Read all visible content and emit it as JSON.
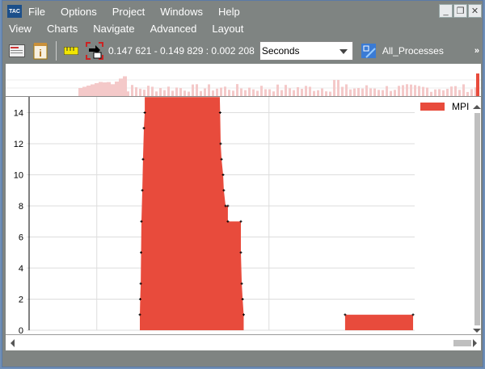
{
  "app": {
    "logo_text": "TAC"
  },
  "menubar1": [
    "File",
    "Options",
    "Project",
    "Windows",
    "Help"
  ],
  "menubar2": [
    "View",
    "Charts",
    "Navigate",
    "Advanced",
    "Layout"
  ],
  "window_controls": {
    "minimize": "_",
    "restore": "❐",
    "close": "✕"
  },
  "toolbar": {
    "icons": [
      "chart-list-icon",
      "info-calendar-icon",
      "ruler-icon",
      "goto-selection-icon"
    ],
    "time_range": "0.147 621 - 0.149 829 : 0.002 208",
    "unit_select": "Seconds",
    "process_group": "All_Processes",
    "overflow": "»"
  },
  "colors": {
    "series": "#e84b3c",
    "overview": "#f4c9c9",
    "chrome": "#7f8482"
  },
  "chart_data": {
    "type": "area",
    "step": true,
    "xlim": [
      0.147621,
      0.149829
    ],
    "xunit": "Seconds",
    "ylim": [
      0,
      15
    ],
    "yticks": [
      0,
      2,
      4,
      6,
      8,
      10,
      12,
      14
    ],
    "grid": true,
    "legend": "top-right",
    "series": [
      {
        "name": "MPI",
        "points": [
          [
            0.148265,
            0
          ],
          [
            0.148265,
            1
          ],
          [
            0.148267,
            2
          ],
          [
            0.14827,
            3
          ],
          [
            0.148272,
            5
          ],
          [
            0.148274,
            7
          ],
          [
            0.148279,
            9
          ],
          [
            0.148283,
            11
          ],
          [
            0.148288,
            13
          ],
          [
            0.148293,
            14
          ],
          [
            0.148293,
            15
          ],
          [
            0.14872,
            15
          ],
          [
            0.148722,
            14
          ],
          [
            0.148725,
            12
          ],
          [
            0.14873,
            11
          ],
          [
            0.148739,
            10
          ],
          [
            0.148743,
            9
          ],
          [
            0.148753,
            8
          ],
          [
            0.148766,
            8
          ],
          [
            0.148766,
            7
          ],
          [
            0.14884,
            7
          ],
          [
            0.14884,
            5
          ],
          [
            0.148845,
            3
          ],
          [
            0.14885,
            2
          ],
          [
            0.148856,
            1
          ],
          [
            0.148856,
            0
          ],
          [
            0.149433,
            0
          ],
          [
            0.149433,
            1
          ],
          [
            0.14982,
            1
          ],
          [
            0.14982,
            0
          ]
        ]
      }
    ]
  }
}
